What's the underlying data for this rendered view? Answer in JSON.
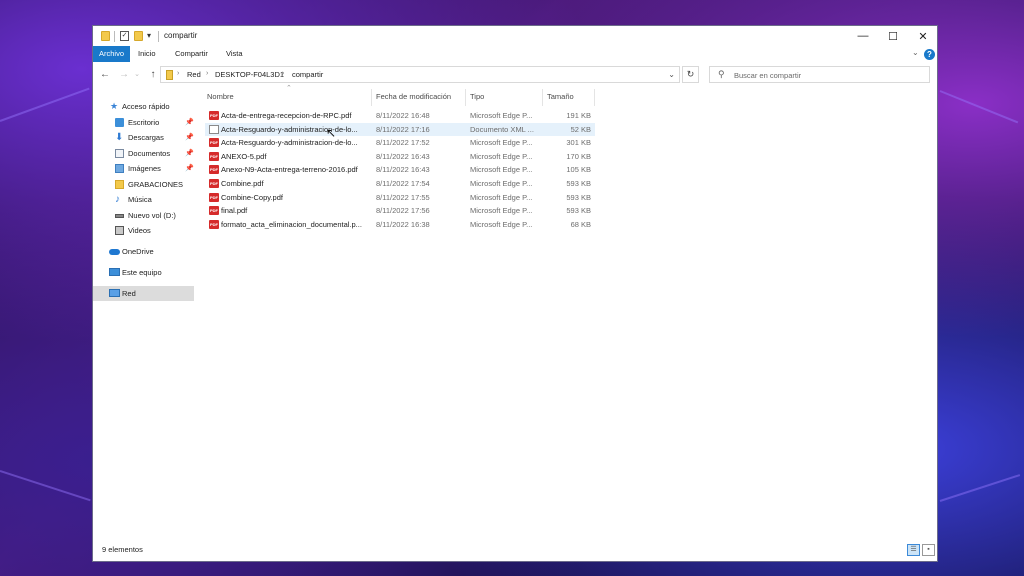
{
  "window": {
    "title": "compartir",
    "controls": {
      "minimize": "—",
      "maximize": "☐",
      "close": "✕"
    }
  },
  "ribbon": {
    "tabs": [
      "Archivo",
      "Inicio",
      "Compartir",
      "Vista"
    ],
    "help": "?"
  },
  "address": {
    "crumbs": [
      "Red",
      "DESKTOP-F04L3D1",
      "compartir"
    ],
    "search_placeholder": "Buscar en compartir"
  },
  "nav": {
    "quick_access": "Acceso rápido",
    "items": [
      {
        "label": "Escritorio",
        "icon": "desktop-icon",
        "pinned": true
      },
      {
        "label": "Descargas",
        "icon": "downloads-icon",
        "pinned": true
      },
      {
        "label": "Documentos",
        "icon": "documents-icon",
        "pinned": true
      },
      {
        "label": "Imágenes",
        "icon": "pictures-icon",
        "pinned": true
      },
      {
        "label": "GRABACIONES",
        "icon": "folder-icon",
        "pinned": false
      },
      {
        "label": "Música",
        "icon": "music-icon",
        "pinned": false
      },
      {
        "label": "Nuevo vol (D:)",
        "icon": "drive-icon",
        "pinned": false
      },
      {
        "label": "Videos",
        "icon": "videos-icon",
        "pinned": false
      }
    ],
    "onedrive": "OneDrive",
    "this_pc": "Este equipo",
    "network": "Red"
  },
  "columns": {
    "name": "Nombre",
    "date": "Fecha de modificación",
    "type": "Tipo",
    "size": "Tamaño"
  },
  "files": [
    {
      "name": "Acta-de-entrega-recepcion-de-RPC.pdf",
      "date": "8/11/2022 16:48",
      "type": "Microsoft Edge P...",
      "size": "191 KB",
      "kind": "pdf"
    },
    {
      "name": "Acta-Resguardo-y-administracion-de-lo...",
      "date": "8/11/2022 17:16",
      "type": "Documento XML ...",
      "size": "52 KB",
      "kind": "xml"
    },
    {
      "name": "Acta-Resguardo-y-administracion-de-lo...",
      "date": "8/11/2022 17:52",
      "type": "Microsoft Edge P...",
      "size": "301 KB",
      "kind": "pdf"
    },
    {
      "name": "ANEXO-5.pdf",
      "date": "8/11/2022 16:43",
      "type": "Microsoft Edge P...",
      "size": "170 KB",
      "kind": "pdf"
    },
    {
      "name": "Anexo-N9-Acta-entrega-terreno-2016.pdf",
      "date": "8/11/2022 16:43",
      "type": "Microsoft Edge P...",
      "size": "105 KB",
      "kind": "pdf"
    },
    {
      "name": "Combine.pdf",
      "date": "8/11/2022 17:54",
      "type": "Microsoft Edge P...",
      "size": "593 KB",
      "kind": "pdf"
    },
    {
      "name": "Combine-Copy.pdf",
      "date": "8/11/2022 17:55",
      "type": "Microsoft Edge P...",
      "size": "593 KB",
      "kind": "pdf"
    },
    {
      "name": "final.pdf",
      "date": "8/11/2022 17:56",
      "type": "Microsoft Edge P...",
      "size": "593 KB",
      "kind": "pdf"
    },
    {
      "name": "formato_acta_eliminacion_documental.p...",
      "date": "8/11/2022 16:38",
      "type": "Microsoft Edge P...",
      "size": "68 KB",
      "kind": "pdf"
    }
  ],
  "status": {
    "count": "9 elementos"
  }
}
